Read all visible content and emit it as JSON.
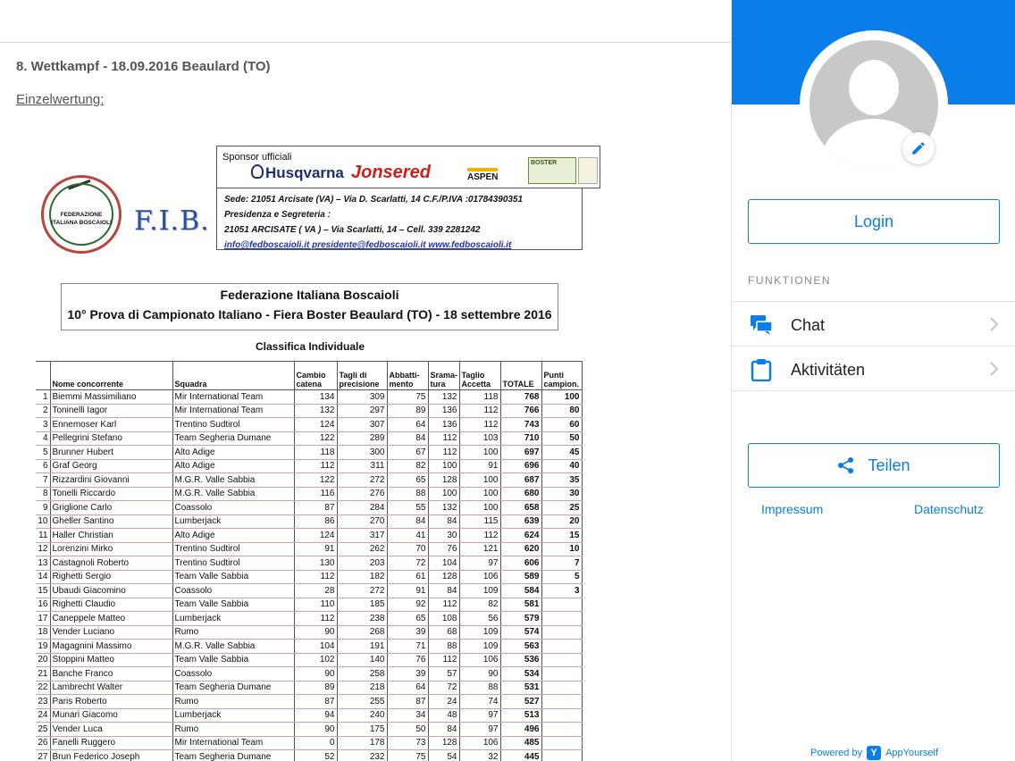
{
  "content": {
    "competition_title": "8. Wettkampf - 18.09.2016 Beaulard (TO)",
    "subheading": "Einzelwertung:"
  },
  "document": {
    "seal_text": "FEDERAZIONE ITALIANA BOSCAIOLI",
    "fib_logo": "F.I.B.",
    "sponsor_label": "Sponsor ufficiali",
    "sponsors": [
      "Husqvarna",
      "Jonsered",
      "ASPEN",
      "BOSTER"
    ],
    "address_lines": [
      "Sede: 21051  Arcisate (VA) – Via D. Scarlatti, 14  C.F./P.IVA :01784390351",
      "Presidenza e Segreteria :",
      "21051  ARCISATE ( VA ) – Via Scarlatti, 14 – Cell. 339 2281242"
    ],
    "address_links": "info@fedboscaioli.it  presidente@fedboscaioli.it  www.fedboscaioli.it",
    "header_line1": "Federazione Italiana Boscaioli",
    "header_line2": "10° Prova di Campionato Italiano - Fiera Boster Beaulard (TO) - 18 settembre 2016",
    "table_title": "Classifica Individuale",
    "columns": [
      "",
      "Nome concorrente",
      "Squadra",
      "Cambio catena",
      "Tagli di precisione",
      "Abbatti- mento",
      "Srama- tura",
      "Taglio Accetta",
      "TOTALE",
      "Punti campion."
    ],
    "rows": [
      [
        "1",
        "Biemmi Massimiliano",
        "Mir International Team",
        "134",
        "309",
        "75",
        "132",
        "118",
        "768",
        "100"
      ],
      [
        "2",
        "Toninelli Iagor",
        "Mir International Team",
        "132",
        "297",
        "89",
        "136",
        "112",
        "766",
        "80"
      ],
      [
        "3",
        "Ennemoser Karl",
        "Trentino Sudtirol",
        "124",
        "307",
        "64",
        "136",
        "112",
        "743",
        "60"
      ],
      [
        "4",
        "Pellegrini Stefano",
        "Team Segheria Dumane",
        "122",
        "289",
        "84",
        "112",
        "103",
        "710",
        "50"
      ],
      [
        "5",
        "Brunner Hubert",
        "Alto Adige",
        "118",
        "300",
        "67",
        "112",
        "100",
        "697",
        "45"
      ],
      [
        "6",
        "Graf Georg",
        "Alto Adige",
        "112",
        "311",
        "82",
        "100",
        "91",
        "696",
        "40"
      ],
      [
        "7",
        "Rizzardini Giovanni",
        "M.G.R. Valle Sabbia",
        "122",
        "272",
        "65",
        "128",
        "100",
        "687",
        "35"
      ],
      [
        "8",
        "Tonelli Riccardo",
        "M.G.R. Valle Sabbia",
        "116",
        "276",
        "88",
        "100",
        "100",
        "680",
        "30"
      ],
      [
        "9",
        "Griglione Carlo",
        "Coassolo",
        "87",
        "284",
        "55",
        "132",
        "100",
        "658",
        "25"
      ],
      [
        "10",
        "Gheller Santino",
        "Lumberjack",
        "86",
        "270",
        "84",
        "84",
        "115",
        "639",
        "20"
      ],
      [
        "11",
        "Haller Christian",
        "Alto Adige",
        "124",
        "317",
        "41",
        "30",
        "112",
        "624",
        "15"
      ],
      [
        "12",
        "Lorenzini Mirko",
        "Trentino Sudtirol",
        "91",
        "262",
        "70",
        "76",
        "121",
        "620",
        "10"
      ],
      [
        "13",
        "Castagnoli Roberto",
        "Trentino Sudtirol",
        "130",
        "203",
        "72",
        "104",
        "97",
        "606",
        "7"
      ],
      [
        "14",
        "Righetti Sergio",
        "Team Valle Sabbia",
        "112",
        "182",
        "61",
        "128",
        "106",
        "589",
        "5"
      ],
      [
        "15",
        "Ubaudi Giacomino",
        "Coassolo",
        "28",
        "272",
        "91",
        "84",
        "109",
        "584",
        "3"
      ],
      [
        "16",
        "Righetti Claudio",
        "Team Valle Sabbia",
        "110",
        "185",
        "92",
        "112",
        "82",
        "581",
        ""
      ],
      [
        "17",
        "Caneppele Matteo",
        "Lumberjack",
        "112",
        "238",
        "65",
        "108",
        "56",
        "579",
        ""
      ],
      [
        "18",
        "Vender Luciano",
        "Rumo",
        "90",
        "268",
        "39",
        "68",
        "109",
        "574",
        ""
      ],
      [
        "19",
        "Magagnini Massimo",
        "M.G.R. Valle Sabbia",
        "104",
        "191",
        "71",
        "88",
        "109",
        "563",
        ""
      ],
      [
        "20",
        "Stoppini Matteo",
        "Team Valle Sabbia",
        "102",
        "140",
        "76",
        "112",
        "106",
        "536",
        ""
      ],
      [
        "21",
        "Banche Franco",
        "Coassolo",
        "90",
        "258",
        "39",
        "57",
        "90",
        "534",
        ""
      ],
      [
        "22",
        "Lambrecht Walter",
        "Team Segheria Dumane",
        "89",
        "218",
        "64",
        "72",
        "88",
        "531",
        ""
      ],
      [
        "23",
        "Paris Roberto",
        "Rumo",
        "87",
        "255",
        "87",
        "24",
        "74",
        "527",
        ""
      ],
      [
        "24",
        "Munari Giacomo",
        "Lumberjack",
        "94",
        "240",
        "34",
        "48",
        "97",
        "513",
        ""
      ],
      [
        "25",
        "Vender Luca",
        "Rumo",
        "90",
        "175",
        "50",
        "84",
        "97",
        "496",
        ""
      ],
      [
        "26",
        "Fanelli Ruggero",
        "Mir International Team",
        "0",
        "178",
        "73",
        "128",
        "106",
        "485",
        ""
      ],
      [
        "27",
        "Brun Federico Joseph",
        "Team Segheria Dumane",
        "52",
        "232",
        "75",
        "54",
        "32",
        "445",
        ""
      ]
    ]
  },
  "panel": {
    "accent_color": "#0a7ee8",
    "login_label": "Login",
    "section_title": "FUNKTIONEN",
    "menu": [
      {
        "label": "Chat",
        "icon": "chat-icon"
      },
      {
        "label": "Aktivitäten",
        "icon": "clipboard-icon"
      }
    ],
    "share_label": "Teilen",
    "impressum": "Impressum",
    "datenschutz": "Datenschutz",
    "powered_by": "Powered by",
    "brand": "AppYourself"
  }
}
